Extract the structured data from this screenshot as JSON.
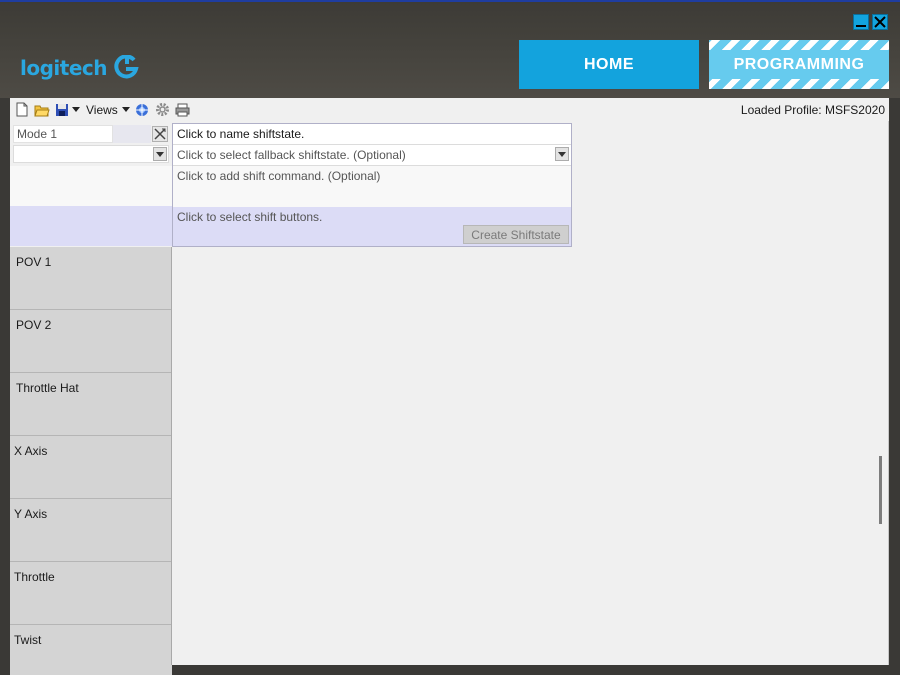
{
  "brand": {
    "logo_text": "logitech",
    "accent": "#13a3dd"
  },
  "window": {
    "minimize_icon": "minimize-icon",
    "close_icon": "close-icon"
  },
  "nav": {
    "home_label": "HOME",
    "programming_label": "PROGRAMMING"
  },
  "toolbar": {
    "views_label": "Views",
    "icons": [
      "new-file-icon",
      "open-folder-icon",
      "save-icon",
      "caret-down-icon",
      "globe-icon",
      "gear-icon",
      "print-icon"
    ],
    "loaded_profile": "Loaded Profile: MSFS2020"
  },
  "mode": {
    "name": "Mode 1",
    "tools_icon": "tools-icon"
  },
  "shiftstate": {
    "name_prompt": "Click to name shiftstate.",
    "fallback_prompt": "Click to select fallback shiftstate. (Optional)",
    "command_prompt": "Click to add shift command. (Optional)",
    "buttons_prompt": "Click to select shift buttons.",
    "create_label": "Create Shiftstate"
  },
  "categories": [
    "POV 1",
    "POV 2",
    "Throttle Hat",
    "X Axis",
    "Y Axis",
    "Throttle",
    "Twist"
  ]
}
